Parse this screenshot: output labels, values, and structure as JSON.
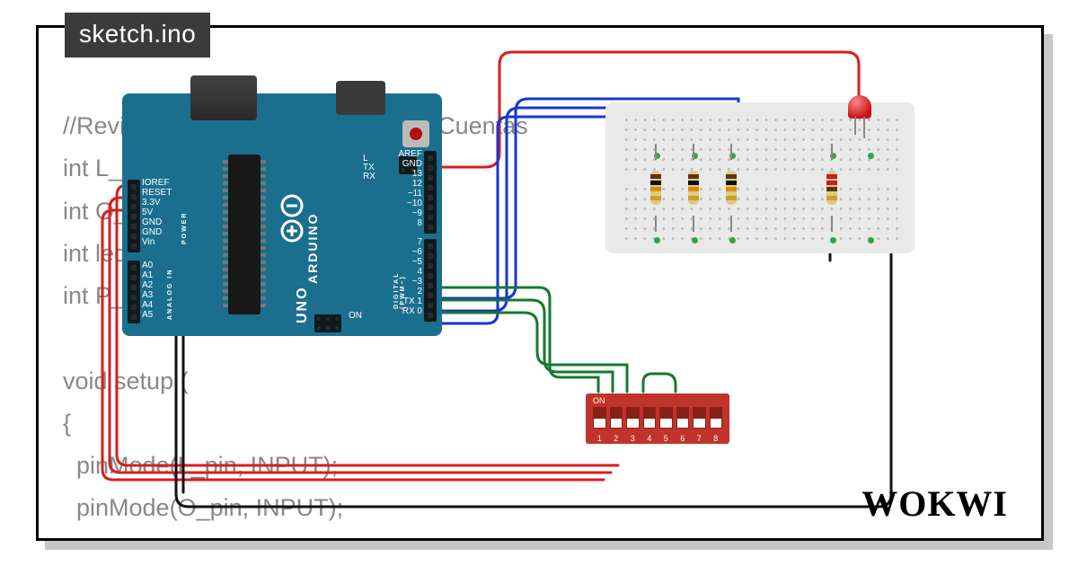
{
  "file_tab": "sketch.ino",
  "code_lines": [
    "//Revisado p                          Uribe Cuentas",
    "int L_pin = 2",
    "int O_pin = 3",
    "int led_pin =",
    "int P_pin = 4",
    "",
    "void setup (",
    "{",
    "  pinMode(L_pin, INPUT);",
    "  pinMode(O_pin, INPUT);"
  ],
  "logo_text": "WOKWI",
  "arduino": {
    "name": "ARDUINO",
    "board": "UNO",
    "power_label": "POWER",
    "analog_label": "ANALOG IN",
    "digital_label": "DIGITAL (PWM~)",
    "tx_label": "TX",
    "rx_label": "RX",
    "l_label": "L",
    "on_label": "ON",
    "power_pins": [
      "IOREF",
      "RESET",
      "3.3V",
      "5V",
      "GND",
      "GND",
      "Vin"
    ],
    "analog_pins": [
      "A0",
      "A1",
      "A2",
      "A3",
      "A4",
      "A5"
    ],
    "digital_left": [
      "AREF",
      "GND",
      "13",
      "12",
      "~11",
      "~10",
      "~9",
      "8"
    ],
    "digital_right": [
      "7",
      "~6",
      "~5",
      "4",
      "~3",
      "2",
      "TX 1",
      "RX 0"
    ]
  },
  "dip": {
    "on_label": "ON",
    "numbers": [
      "1",
      "2",
      "3",
      "4",
      "5",
      "6",
      "7",
      "8"
    ]
  },
  "components": {
    "resistors": [
      {
        "type": "10k",
        "bands": [
          "#5a3510",
          "#111",
          "#d88b00",
          "#caa02a"
        ]
      },
      {
        "type": "10k",
        "bands": [
          "#5a3510",
          "#111",
          "#d88b00",
          "#caa02a"
        ]
      },
      {
        "type": "10k",
        "bands": [
          "#5a3510",
          "#111",
          "#d88b00",
          "#caa02a"
        ]
      },
      {
        "type": "220",
        "bands": [
          "#c41e1e",
          "#c41e1e",
          "#5a3510",
          "#caa02a"
        ]
      }
    ],
    "led": {
      "color": "red"
    }
  },
  "wires": {
    "colors": {
      "power": "#d81e1e",
      "ground": "#111",
      "signal_blue": "#1536d1",
      "signal_green": "#147a2e"
    }
  }
}
